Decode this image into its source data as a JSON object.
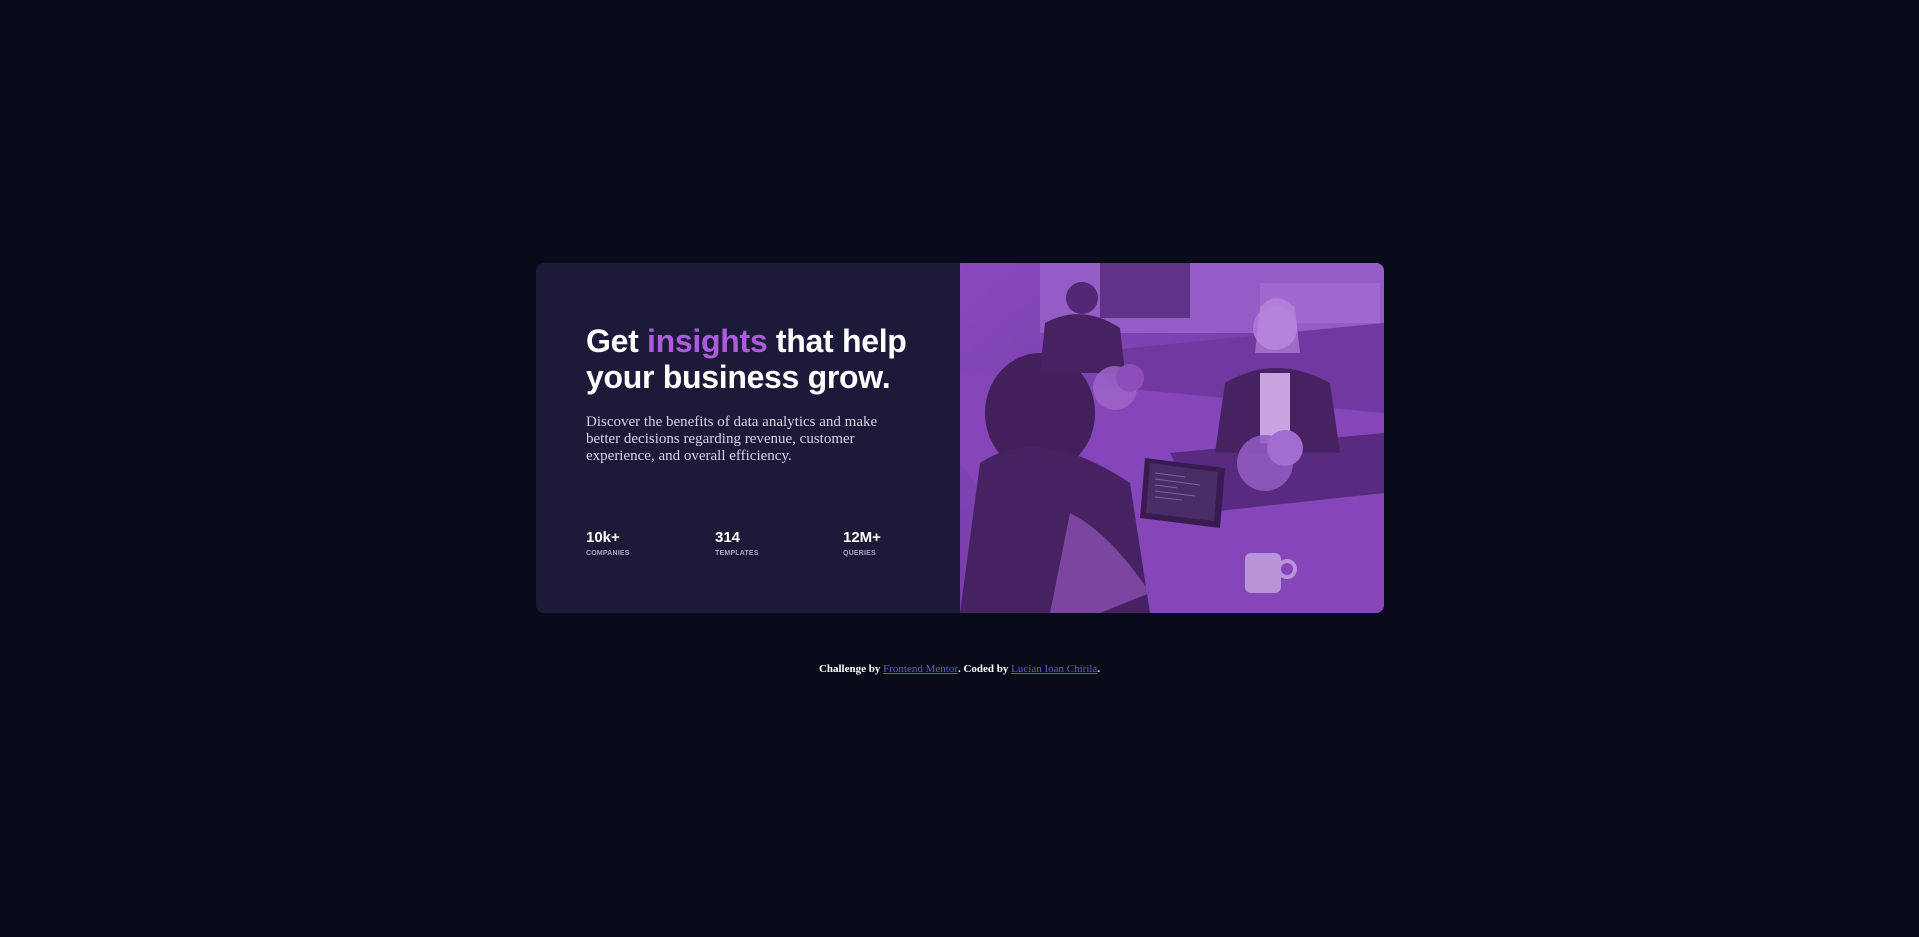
{
  "card": {
    "headline": {
      "before": "Get ",
      "accent": "insights",
      "after": " that help your business grow."
    },
    "description": "Discover the benefits of data analytics and make better decisions regarding revenue, customer experience, and overall efficiency.",
    "stats": [
      {
        "value": "10k+",
        "label": "COMPANIES"
      },
      {
        "value": "314",
        "label": "TEMPLATES"
      },
      {
        "value": "12M+",
        "label": "QUERIES"
      }
    ],
    "image": {
      "subject": "people working at a desk with laptops"
    }
  },
  "attribution": {
    "prefix": "Challenge by ",
    "link1": "Frontend Mentor",
    "middle": ". Coded by ",
    "link2": "Lucian Ioan Chirila",
    "suffix": "."
  },
  "colors": {
    "background": "#090b1a",
    "card": "#1c1a38",
    "accent": "#aa5cdb",
    "image_overlay": "#7a3fb0",
    "link": "#5a5fc8"
  }
}
